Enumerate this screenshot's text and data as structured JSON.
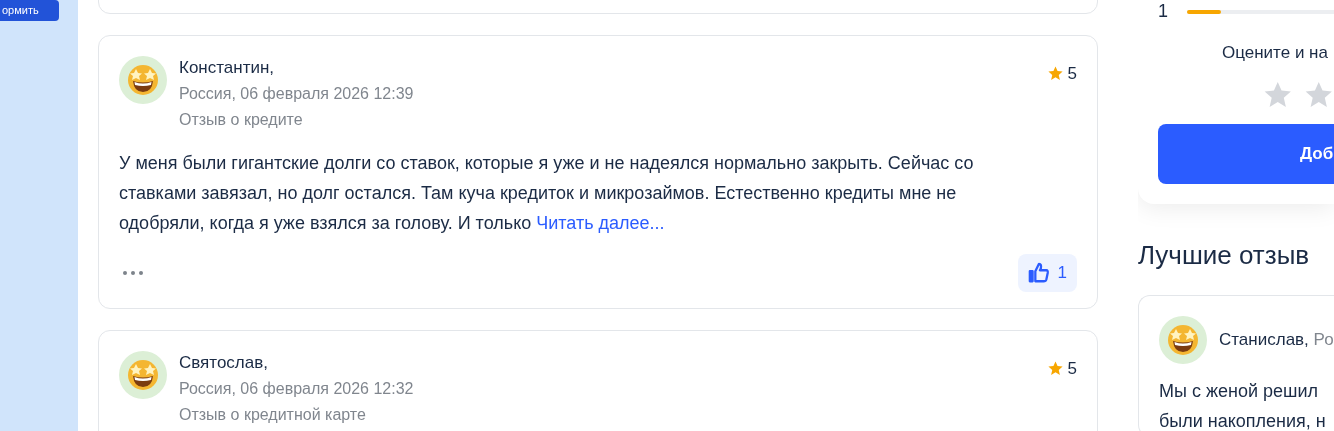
{
  "sidebar": {
    "button": "ормить"
  },
  "reviews": [
    {
      "author": "Константин,",
      "meta": "Россия, 06 февраля 2026 12:39",
      "topic": "Отзыв о кредите",
      "rating": "5",
      "text": "У меня были гигантские долги со ставок, которые я уже и не надеялся нормально закрыть. Сейчас со ставками завязал, но долг остался. Там куча кредиток и микрозаймов. Естественно кредиты мне не одобряли, когда я уже взялся за голову. И только",
      "more": "Читать далее...",
      "likes": "1"
    },
    {
      "author": "Святослав,",
      "meta": "Россия, 06 февраля 2026 12:32",
      "topic": "Отзыв о кредитной карте",
      "rating": "5"
    }
  ],
  "rating_panel": {
    "distribution": [
      {
        "label": "1",
        "level": 0.12
      }
    ],
    "prompt": "Оцените и на",
    "button": "Доб"
  },
  "best_reviews": {
    "title": "Лучшие отзыв",
    "items": [
      {
        "author": "Станислав,",
        "meta": "Ро",
        "text_lines": [
          "Мы с женой решил",
          "были накопления, н"
        ]
      }
    ]
  }
}
